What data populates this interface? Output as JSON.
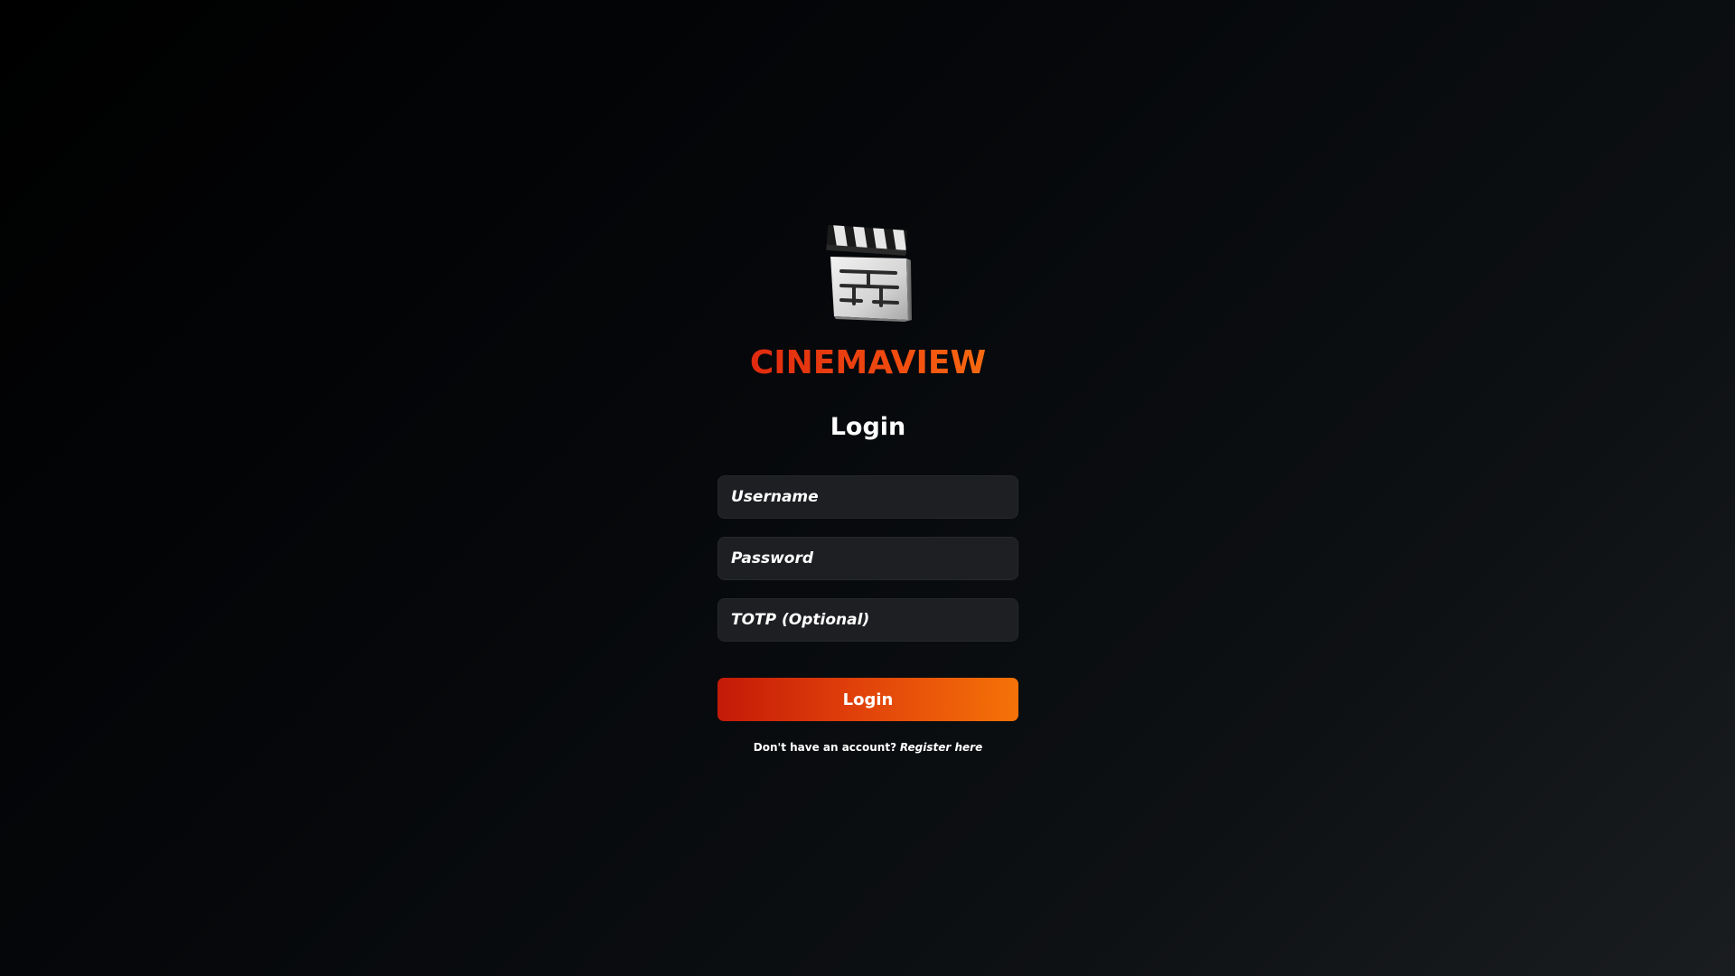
{
  "app": {
    "brand": "CINEMAVIEW",
    "logo_icon": "clapperboard-icon"
  },
  "form": {
    "title": "Login",
    "username_placeholder": "Username",
    "password_placeholder": "Password",
    "totp_placeholder": "TOTP (Optional)",
    "submit_label": "Login"
  },
  "footer": {
    "prompt": "Don't have an account?",
    "register_link": "Register here"
  },
  "colors": {
    "accent_start": "#c31a08",
    "accent_end": "#f57208",
    "field_background": "#1e1f22",
    "page_background": "#000000"
  }
}
